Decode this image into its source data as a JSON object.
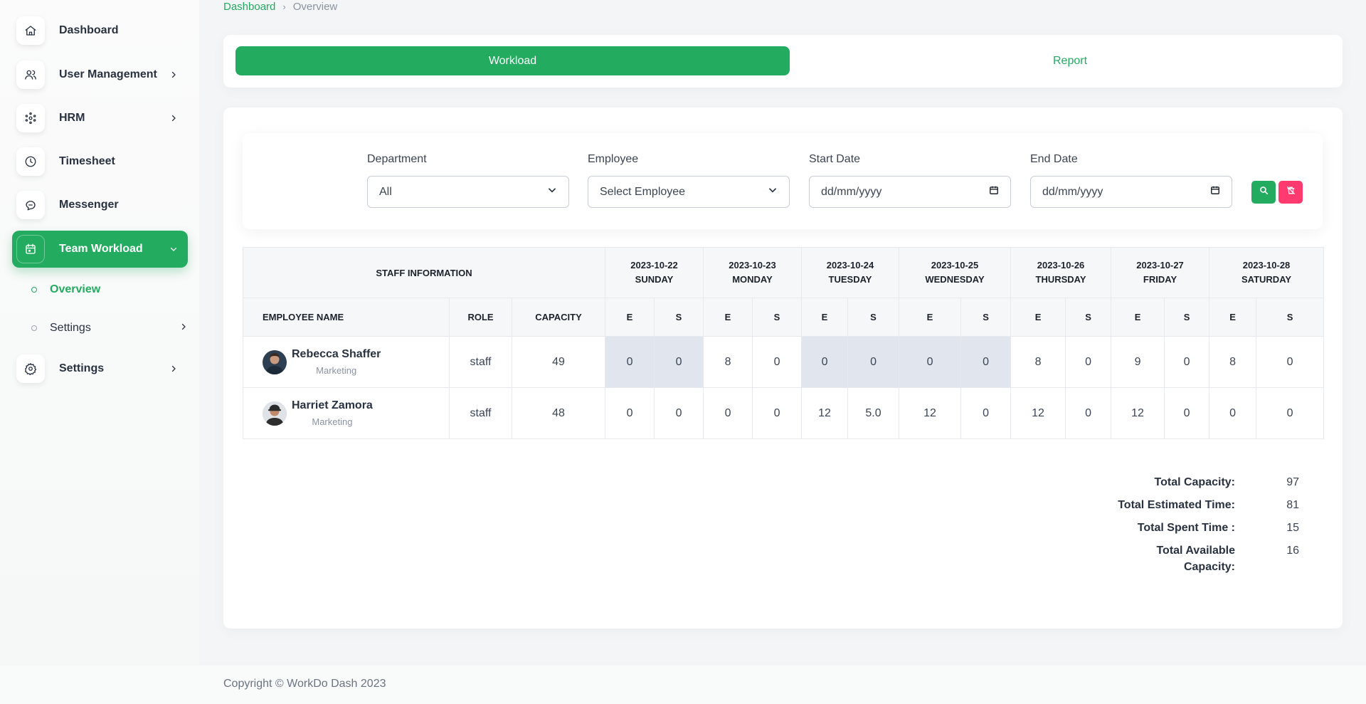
{
  "sidebar": {
    "items": [
      {
        "label": "Dashboard",
        "icon": "home-icon"
      },
      {
        "label": "User Management",
        "icon": "users-icon"
      },
      {
        "label": "HRM",
        "icon": "hrm-icon"
      },
      {
        "label": "Timesheet",
        "icon": "clock-icon"
      },
      {
        "label": "Messenger",
        "icon": "chat-icon"
      },
      {
        "label": "Team Workload",
        "icon": "calendar-icon"
      },
      {
        "label": "Settings",
        "icon": "gear-icon"
      }
    ],
    "subitems": [
      {
        "label": "Overview"
      },
      {
        "label": "Settings"
      }
    ],
    "accent": "#23ac60"
  },
  "breadcrumb": {
    "root": "Dashboard",
    "current": "Overview"
  },
  "tabs": {
    "workload": "Workload",
    "report": "Report"
  },
  "filters": {
    "department": {
      "label": "Department",
      "value": "All"
    },
    "employee": {
      "label": "Employee",
      "value": "Select Employee"
    },
    "start_date": {
      "label": "Start Date",
      "value": "dd/mm/yyyy"
    },
    "end_date": {
      "label": "End Date",
      "value": "dd/mm/yyyy"
    }
  },
  "table": {
    "staff_header": "STAFF INFORMATION",
    "col_employee": "EMPLOYEE NAME",
    "col_role": "ROLE",
    "col_capacity": "CAPACITY",
    "est_label": "E",
    "spent_label": "S",
    "days": [
      {
        "date": "2023-10-22",
        "day": "SUNDAY"
      },
      {
        "date": "2023-10-23",
        "day": "MONDAY"
      },
      {
        "date": "2023-10-24",
        "day": "TUESDAY"
      },
      {
        "date": "2023-10-25",
        "day": "WEDNESDAY"
      },
      {
        "date": "2023-10-26",
        "day": "THURSDAY"
      },
      {
        "date": "2023-10-27",
        "day": "FRIDAY"
      },
      {
        "date": "2023-10-28",
        "day": "SATURDAY"
      }
    ],
    "rows": [
      {
        "name": "Rebecca Shaffer",
        "department": "Marketing",
        "role": "staff",
        "capacity": "49",
        "values": [
          "0",
          "0",
          "8",
          "0",
          "0",
          "0",
          "0",
          "0",
          "8",
          "0",
          "9",
          "0",
          "8",
          "0"
        ],
        "shaded_days": [
          0,
          2,
          3
        ]
      },
      {
        "name": "Harriet Zamora",
        "department": "Marketing",
        "role": "staff",
        "capacity": "48",
        "values": [
          "0",
          "0",
          "0",
          "0",
          "12",
          "5.0",
          "12",
          "0",
          "12",
          "0",
          "12",
          "0",
          "0",
          "0"
        ],
        "shaded_days": []
      }
    ]
  },
  "totals": [
    {
      "label": "Total Capacity:",
      "value": "97"
    },
    {
      "label": "Total Estimated Time:",
      "value": "81"
    },
    {
      "label": "Total Spent Time :",
      "value": "15"
    },
    {
      "label": "Total Available Capacity:",
      "value": "16"
    }
  ],
  "footer": {
    "copyright": "Copyright © WorkDo Dash 2023"
  }
}
